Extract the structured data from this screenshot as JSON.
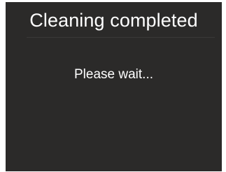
{
  "screen": {
    "title": "Cleaning completed",
    "message": "Please wait...",
    "colors": {
      "background": "#2b2a29",
      "text": "#ffffff"
    }
  }
}
